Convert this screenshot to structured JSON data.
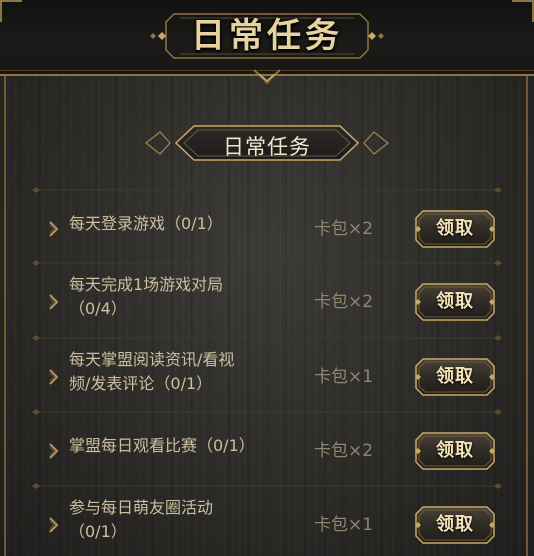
{
  "header": {
    "title": "日常任务"
  },
  "section": {
    "title": "日常任务"
  },
  "tasks": [
    {
      "name_lines": [
        "每天登录游戏（0/1）"
      ],
      "reward": "卡包×2",
      "button": "领取"
    },
    {
      "name_lines": [
        "每天完成1场游戏对局",
        "（0/4）"
      ],
      "reward": "卡包×2",
      "button": "领取"
    },
    {
      "name_lines": [
        "每天掌盟阅读资讯/看视",
        "频/发表评论（0/1）"
      ],
      "reward": "卡包×1",
      "button": "领取"
    },
    {
      "name_lines": [
        "掌盟每日观看比赛（0/1）"
      ],
      "reward": "卡包×2",
      "button": "领取"
    },
    {
      "name_lines": [
        "参与每日萌友圈活动",
        "（0/1）"
      ],
      "reward": "卡包×1",
      "button": "领取"
    }
  ],
  "colors": {
    "gold": "#c9a86a",
    "gold_dark": "#7a6238",
    "text": "#cdbf9e",
    "reward_text": "#8f8670"
  }
}
